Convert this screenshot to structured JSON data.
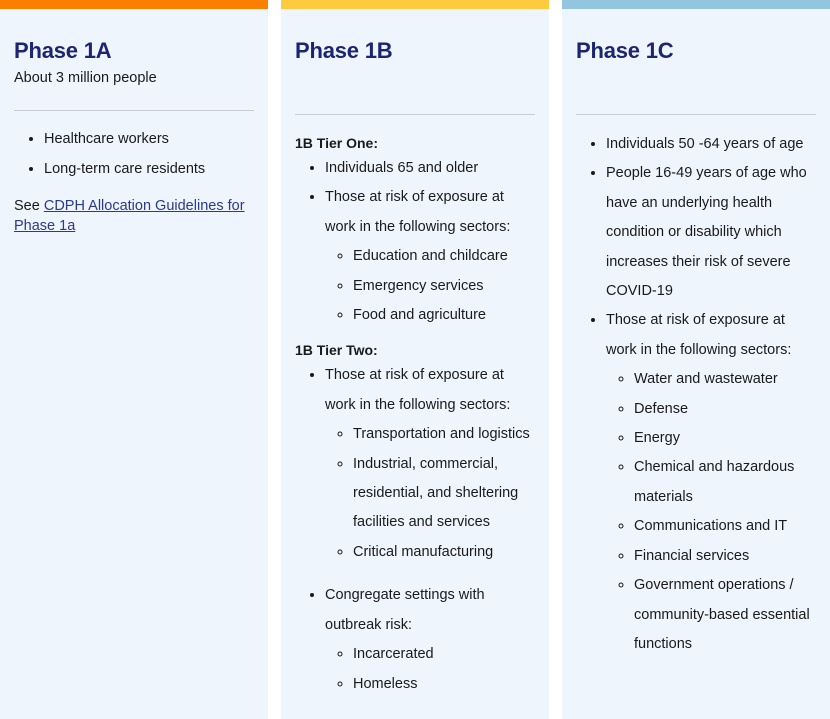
{
  "phases": [
    {
      "title": "Phase 1A",
      "subtitle": "About 3 million people",
      "accent_color": "#fd7f00",
      "items": [
        "Healthcare workers",
        "Long-term care residents"
      ],
      "see_prefix": "See ",
      "link_text": "CDPH Allocation Guidelines for Phase 1a"
    },
    {
      "title": "Phase 1B",
      "accent_color": "#fecb3f",
      "tier_one": {
        "label": "1B Tier One:",
        "items": [
          {
            "text": "Individuals 65 and older"
          },
          {
            "text": "Those at risk of exposure at work in the following sectors:",
            "subitems": [
              "Education and childcare",
              "Emergency services",
              "Food and agriculture"
            ]
          }
        ]
      },
      "tier_two": {
        "label": "1B Tier Two:",
        "items": [
          {
            "text": "Those at risk of exposure at work in the following sectors:",
            "subitems": [
              "Transportation and logistics",
              "Industrial, commercial, residential, and sheltering facilities and services",
              "Critical manufacturing"
            ]
          },
          {
            "text": "Congregate settings with outbreak risk:",
            "subitems": [
              "Incarcerated",
              "Homeless"
            ]
          }
        ]
      }
    },
    {
      "title": "Phase 1C",
      "accent_color": "#93c5e0",
      "items": [
        {
          "text": "Individuals 50 -64 years of age"
        },
        {
          "text": "People 16-49 years of age who have an underlying health condition or disability which increases their risk of severe COVID-19"
        },
        {
          "text": "Those at risk of exposure at work in the following sectors:",
          "subitems": [
            "Water and wastewater",
            "Defense",
            "Energy",
            "Chemical and hazardous materials",
            "Communications and IT",
            "Financial services",
            "Government operations / community-based essential functions"
          ]
        }
      ]
    }
  ]
}
